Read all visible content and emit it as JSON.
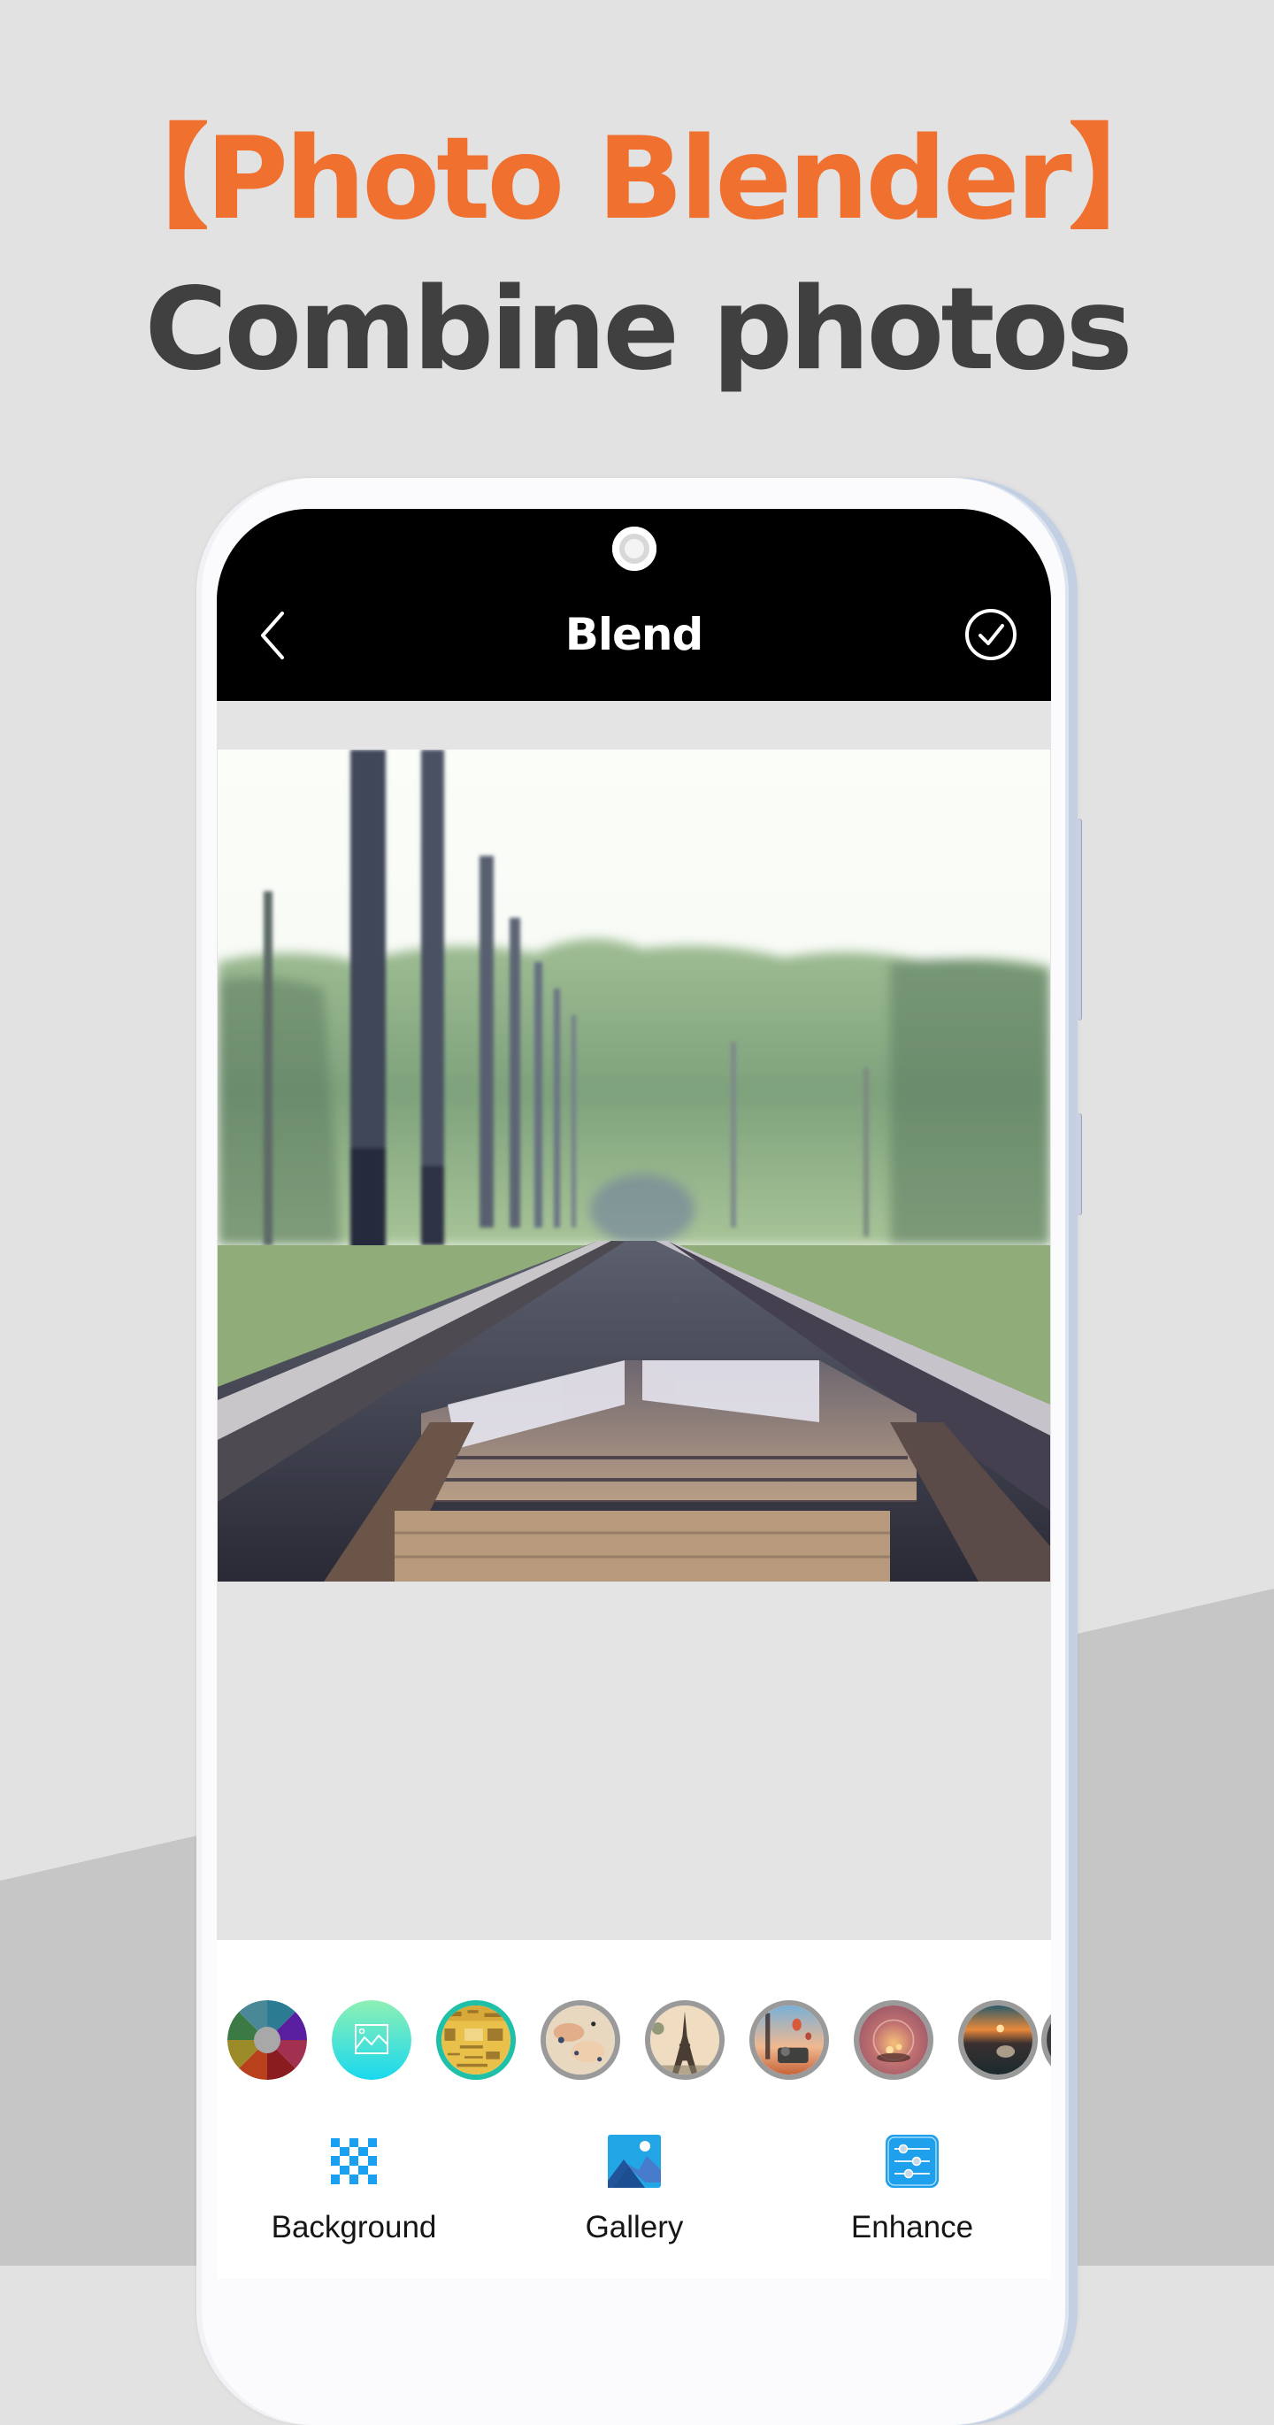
{
  "promo": {
    "headline_1": "【Photo Blender】",
    "headline_2": "Combine photos",
    "accent_color": "#f07030",
    "text_color": "#404040"
  },
  "app": {
    "header": {
      "title": "Blend",
      "back_icon": "chevron-left-icon",
      "confirm_icon": "check-circle-icon"
    },
    "canvas": {
      "photo_description": "railway tracks receding into a forest with utility poles"
    },
    "blend_options": [
      {
        "name": "color-picker",
        "icon": "color-wheel-icon",
        "selected": false
      },
      {
        "name": "pick-from-gallery",
        "icon": "image-icon",
        "selected": false
      },
      {
        "name": "newspaper-texture",
        "icon": "newspaper-thumbnail",
        "selected": true
      },
      {
        "name": "flowers",
        "icon": "flowers-thumbnail",
        "selected": false
      },
      {
        "name": "eiffel-tower",
        "icon": "eiffel-tower-thumbnail",
        "selected": false
      },
      {
        "name": "city-balloons",
        "icon": "city-thumbnail",
        "selected": false
      },
      {
        "name": "bokeh-glass",
        "icon": "bokeh-thumbnail",
        "selected": false
      },
      {
        "name": "sunset-lake",
        "icon": "sunset-thumbnail",
        "selected": false
      },
      {
        "name": "more",
        "icon": "partial-thumbnail",
        "selected": false
      }
    ],
    "selected_color": "#20c0a8",
    "bottom_nav": [
      {
        "label": "Background",
        "icon": "checkerboard-icon"
      },
      {
        "label": "Gallery",
        "icon": "gallery-icon"
      },
      {
        "label": "Enhance",
        "icon": "sliders-icon"
      }
    ]
  }
}
